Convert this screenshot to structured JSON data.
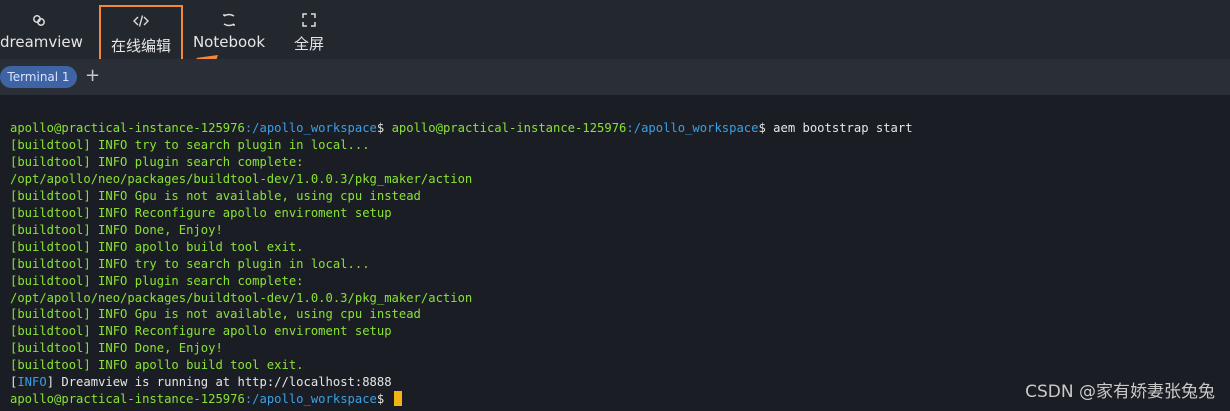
{
  "toolbar": {
    "items": [
      {
        "label": "dreamview",
        "icon": "link-icon"
      },
      {
        "label": "在线编辑",
        "icon": "code-icon"
      },
      {
        "label": "Notebook",
        "icon": "notebook-icon"
      },
      {
        "label": "全屏",
        "icon": "fullscreen-icon"
      }
    ],
    "highlight_color": "#f3883a"
  },
  "tabs": {
    "active": "Terminal 1",
    "add_label": "+"
  },
  "terminal": {
    "prompt_user": "apollo@practical-instance-125976",
    "prompt_path": ":/apollo_workspace",
    "prompt_suffix": "$ ",
    "command": "aem bootstrap start",
    "lines": [
      "[buildtool] INFO try to search plugin in local...",
      "[buildtool] INFO plugin search complete:",
      "/opt/apollo/neo/packages/buildtool-dev/1.0.0.3/pkg_maker/action",
      "[buildtool] INFO Gpu is not available, using cpu instead",
      "[buildtool] INFO Reconfigure apollo enviroment setup",
      "[buildtool] INFO Done, Enjoy!",
      "[buildtool] INFO apollo build tool exit.",
      "[buildtool] INFO try to search plugin in local...",
      "[buildtool] INFO plugin search complete:",
      "/opt/apollo/neo/packages/buildtool-dev/1.0.0.3/pkg_maker/action",
      "[buildtool] INFO Gpu is not available, using cpu instead",
      "[buildtool] INFO Reconfigure apollo enviroment setup",
      "[buildtool] INFO Done, Enjoy!",
      "[buildtool] INFO apollo build tool exit."
    ],
    "info_open": "[",
    "info_tag": "INFO",
    "info_rest": "] Dreamview is running at http://localhost:8888"
  },
  "watermark": "CSDN @家有娇妻张兔兔"
}
